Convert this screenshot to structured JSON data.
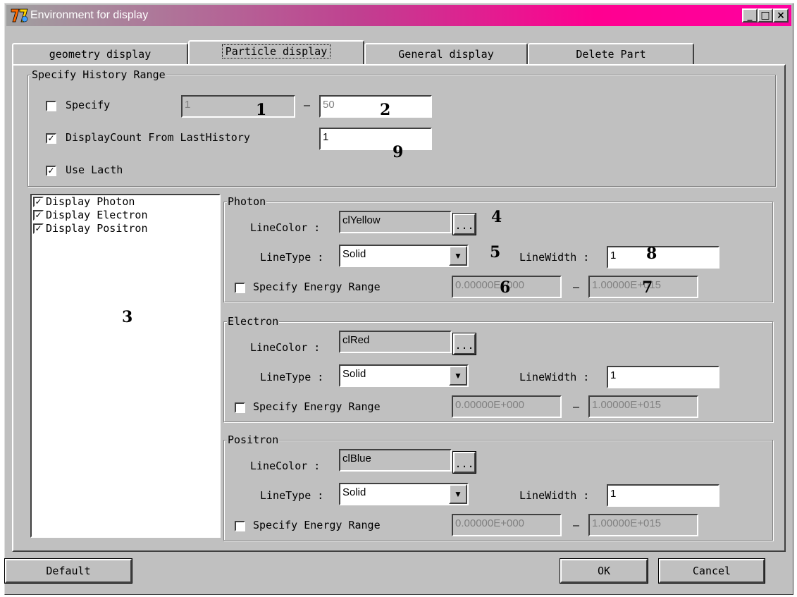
{
  "window": {
    "title": "Environment for display",
    "min_symbol": "_",
    "max_symbol": "□",
    "close_symbol": "×"
  },
  "tabs": [
    "geometry display",
    "Particle display",
    "General display",
    "Delete Part"
  ],
  "history": {
    "group_title": "Specify History Range",
    "specify_label": "Specify",
    "range_from": "1",
    "range_to": "50",
    "dash": "–",
    "display_count_label": "DisplayCount From LastHistory",
    "display_count_value": "1",
    "use_latch_label": "Use Lacth"
  },
  "particle_list": [
    "Display Photon",
    "Display Electron",
    "Display Positron"
  ],
  "check_mark": "✓",
  "labels": {
    "line_color": "LineColor :",
    "line_type": "LineType :",
    "line_width": "LineWidth :",
    "energy_range": "Specify Energy Range",
    "ellipsis": "...",
    "combo_arrow": "▼",
    "dash": "–"
  },
  "photon": {
    "title": "Photon",
    "color": "clYellow",
    "line_type": "Solid",
    "line_width": "1",
    "energy_min": "0.00000E+000",
    "energy_max": "1.00000E+015"
  },
  "electron": {
    "title": "Electron",
    "color": "clRed",
    "line_type": "Solid",
    "line_width": "1",
    "energy_min": "0.00000E+000",
    "energy_max": "1.00000E+015"
  },
  "positron": {
    "title": "Positron",
    "color": "clBlue",
    "line_type": "Solid",
    "line_width": "1",
    "energy_min": "0.00000E+000",
    "energy_max": "1.00000E+015"
  },
  "buttons": {
    "default": "Default",
    "ok": "OK",
    "cancel": "Cancel"
  },
  "annotations": [
    "1",
    "2",
    "3",
    "4",
    "5",
    "6",
    "7",
    "8",
    "9"
  ],
  "colors": {
    "title_gradient_start": "#a0a0a0",
    "title_gradient_end": "#ff00a0",
    "face": "#c0c0c0"
  }
}
